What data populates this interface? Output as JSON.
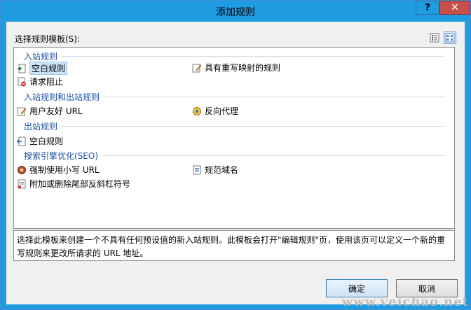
{
  "window": {
    "title": "添加规则",
    "help_label": "?",
    "close_label": "✕"
  },
  "template_label": "选择规则模板(S):",
  "groups": [
    {
      "header": "入站规则",
      "items": [
        {
          "label": "空白规则",
          "icon": "blank-inbound-rule-icon",
          "selected": true
        },
        {
          "label": "具有重写映射的规则",
          "icon": "rewrite-map-rule-icon"
        },
        {
          "label": "请求阻止",
          "icon": "request-blocking-icon"
        }
      ]
    },
    {
      "header": "入站规则和出站规则",
      "items": [
        {
          "label": "用户友好 URL",
          "icon": "user-friendly-url-icon"
        },
        {
          "label": "反向代理",
          "icon": "reverse-proxy-icon"
        }
      ]
    },
    {
      "header": "出站规则",
      "items": [
        {
          "label": "空白规则",
          "icon": "blank-outbound-rule-icon"
        }
      ]
    },
    {
      "header": "搜索引擎优化(SEO)",
      "items": [
        {
          "label": "强制使用小写 URL",
          "icon": "lowercase-url-icon"
        },
        {
          "label": "规范域名",
          "icon": "canonical-domain-icon"
        },
        {
          "label": "附加或删除尾部反斜杠符号",
          "icon": "trailing-slash-icon"
        }
      ]
    }
  ],
  "description": "选择此模板来创建一个不具有任何预设值的新入站规则。此模板会打开\"编辑规则\"页，使用该页可以定义一个新的重写规则来更改所请求的 URL 地址。",
  "buttons": {
    "ok": "确定",
    "cancel": "取消"
  },
  "watermark": "www.veichao.net",
  "colors": {
    "titlebar": "#1e9be1",
    "close": "#c7504a",
    "group_header": "#1b4fa1",
    "selection": "#cce4f7"
  }
}
